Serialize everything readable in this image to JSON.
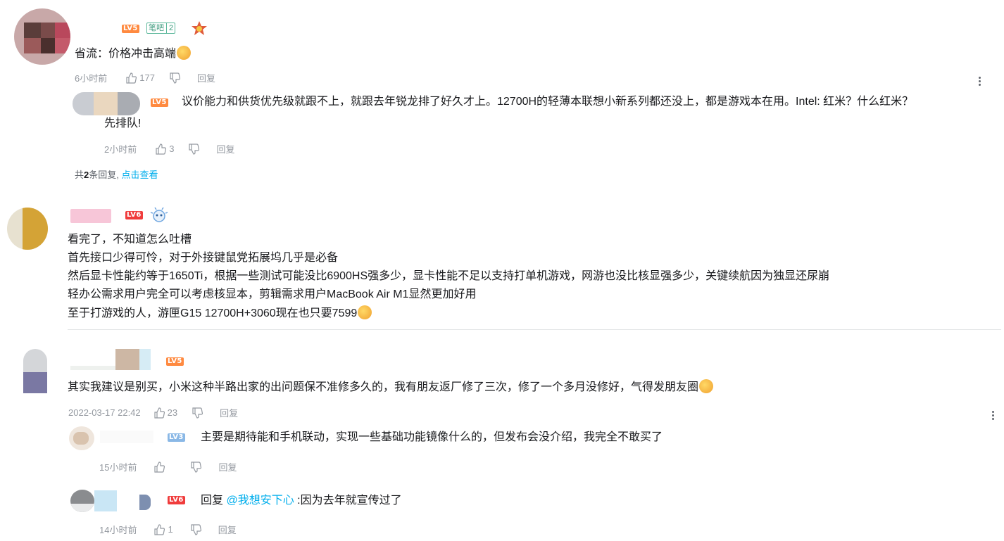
{
  "comments": [
    {
      "level": "LV5",
      "fan_badge": {
        "name": "笔吧",
        "level": "2"
      },
      "text": "省流：价格冲击高端",
      "time": "6小时前",
      "likes": "177",
      "reply_label": "回复",
      "replies": [
        {
          "level": "LV5",
          "text_line1": "议价能力和供货优先级就跟不上，就跟去年锐龙排了好久才上。12700H的轻薄本联想小新系列都还没上，都是游戏本在用。Intel: 红米？什么红米？",
          "text_line2": "先排队!",
          "time": "2小时前",
          "likes": "3",
          "reply_label": "回复"
        }
      ],
      "summary_prefix": "共",
      "summary_count": "2",
      "summary_suffix": "条回复,",
      "summary_link": "点击查看"
    },
    {
      "level": "LV6",
      "lines": [
        "看完了，不知道怎么吐槽",
        "首先接口少得可怜，对于外接键鼠党拓展坞几乎是必备",
        "然后显卡性能约等于1650Ti，根据一些测试可能没比6900HS强多少，显卡性能不足以支持打单机游戏，网游也没比核显强多少，关键续航因为独显还尿崩",
        "轻办公需求用户完全可以考虑核显本，剪辑需求用户MacBook Air M1显然更加好用",
        "至于打游戏的人，游匣G15 12700H+3060现在也只要7599"
      ]
    },
    {
      "level": "LV5",
      "text": "其实我建议是别买，小米这种半路出家的出问题保不准修多久的，我有朋友返厂修了三次，修了一个多月没修好，气得发朋友圈",
      "time": "2022-03-17 22:42",
      "likes": "23",
      "reply_label": "回复",
      "replies": [
        {
          "level": "LV3",
          "text": "主要是期待能和手机联动，实现一些基础功能镜像什么的，但发布会没介绍，我完全不敢买了",
          "time": "15小时前",
          "likes": "",
          "reply_label": "回复"
        },
        {
          "level": "LV6",
          "reply_prefix": "回复",
          "mention": "@我想安下心",
          "text": ":因为去年就宣传过了",
          "time": "14小时前",
          "likes": "1",
          "reply_label": "回复"
        }
      ]
    }
  ],
  "colors": {
    "accent_link": "#00aeec",
    "meta": "#9499a0",
    "lv5": "#ff8a40",
    "lv6": "#f03c3c",
    "lv3": "#8ab8e6"
  },
  "icons": [
    "thumb-up-icon",
    "thumb-down-icon",
    "more-vertical-icon",
    "emoji-icon",
    "medal-icon",
    "pendant-icon"
  ]
}
